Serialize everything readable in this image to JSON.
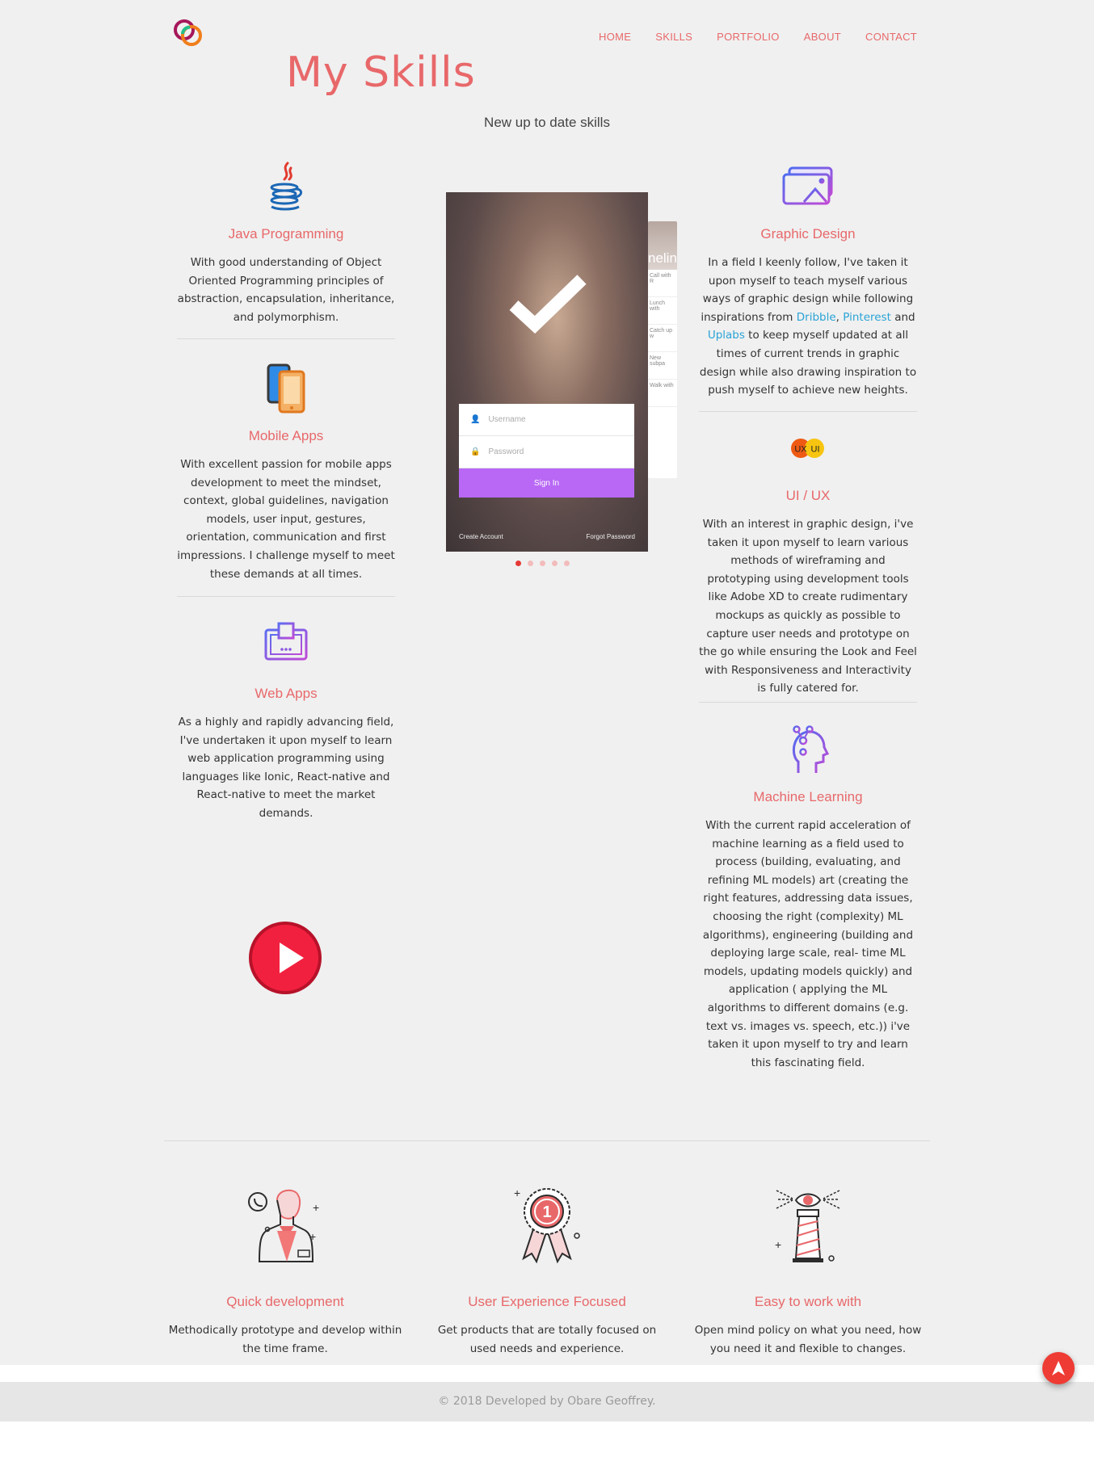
{
  "nav": {
    "items": [
      "HOME",
      "SKILLS",
      "PORTFOLIO",
      "ABOUT",
      "CONTACT"
    ]
  },
  "header": {
    "title": "My Skills",
    "subtitle": "New up to date skills"
  },
  "skills_left": [
    {
      "icon": "java-icon",
      "title": "Java Programming",
      "text": "With good understanding of Object Oriented Programming principles of abstraction, encapsulation, inheritance, and polymorphism."
    },
    {
      "icon": "mobile-phone-icon",
      "title": "Mobile Apps",
      "text": "With excellent passion for mobile apps development to meet the mindset, context, global guidelines, navigation models, user input, gestures, orientation, communication and first impressions. I challenge myself to meet these demands at all times."
    },
    {
      "icon": "web-monitor-icon",
      "title": "Web Apps",
      "text": "As a highly and rapidly advancing field, I've undertaken it upon myself to learn web application programming using languages like Ionic, React-native and React-native to meet the market demands."
    }
  ],
  "skills_right": [
    {
      "icon": "graphic-design-icon",
      "title": "Graphic Design",
      "text_a": "In a field I keenly follow, I've taken it upon myself to teach myself various ways of graphic design while following inspirations from ",
      "link_dribble": "Dribble",
      "sep_comma": ", ",
      "link_pinterest": "Pinterest",
      "text_and": " and ",
      "link_uplabs": "Uplabs",
      "text_b": " to keep myself updated at all times of current trends in graphic design while also drawing inspiration to push myself to achieve new heights."
    },
    {
      "icon": "ux-ui-icon",
      "badge_ux": "UX",
      "badge_ui": "UI",
      "title": "UI / UX",
      "text": "With an interest in graphic design, i've taken it upon myself to learn various methods of wireframing and prototyping using development tools like Adobe XD to create rudimentary mockups as quickly as possible to capture user needs and prototype on the go while ensuring the Look and Feel with Responsiveness and Interactivity is fully catered for."
    },
    {
      "icon": "machine-learning-head-icon",
      "title": "Machine Learning",
      "text": "With the current rapid acceleration of machine learning as a field used to process (building, evaluating, and refining ML models) art (creating the right features, addressing data issues, choosing the right (complexity) ML algorithms), engineering (building and deploying large scale, real- time ML models, updating models quickly) and application ( applying the ML algorithms to different domains (e.g. text vs. images vs. speech, etc.)) i've taken it upon myself to try and learn this fascinating field."
    }
  ],
  "carousel": {
    "back_header": "neline",
    "back_rows": [
      "Call with R",
      "Lunch with",
      "Catch up w",
      "New subpa",
      "Walk with"
    ],
    "username_placeholder": "Username",
    "password_placeholder": "Password",
    "sign_in": "Sign In",
    "create_account": "Create Account",
    "forgot_password": "Forgot Password",
    "slides": 5,
    "active_slide": 1
  },
  "features": [
    {
      "icon": "developer-icon",
      "title": "Quick development",
      "text": "Methodically prototype and develop within the time frame."
    },
    {
      "icon": "award-badge-icon",
      "badge_number": "1",
      "title": "User Experience Focused",
      "text": "Get products that are totally focused on used needs and experience."
    },
    {
      "icon": "lighthouse-icon",
      "title": "Easy to work with",
      "text": "Open mind policy on what you need, how you need it and flexible to changes."
    }
  ],
  "footer": {
    "text": "© 2018 Developed by Obare Geoffrey."
  },
  "colors": {
    "accent": "#e8686a",
    "link": "#2aa3d6",
    "play": "#f2203f",
    "sign_in": "#b868f5"
  }
}
